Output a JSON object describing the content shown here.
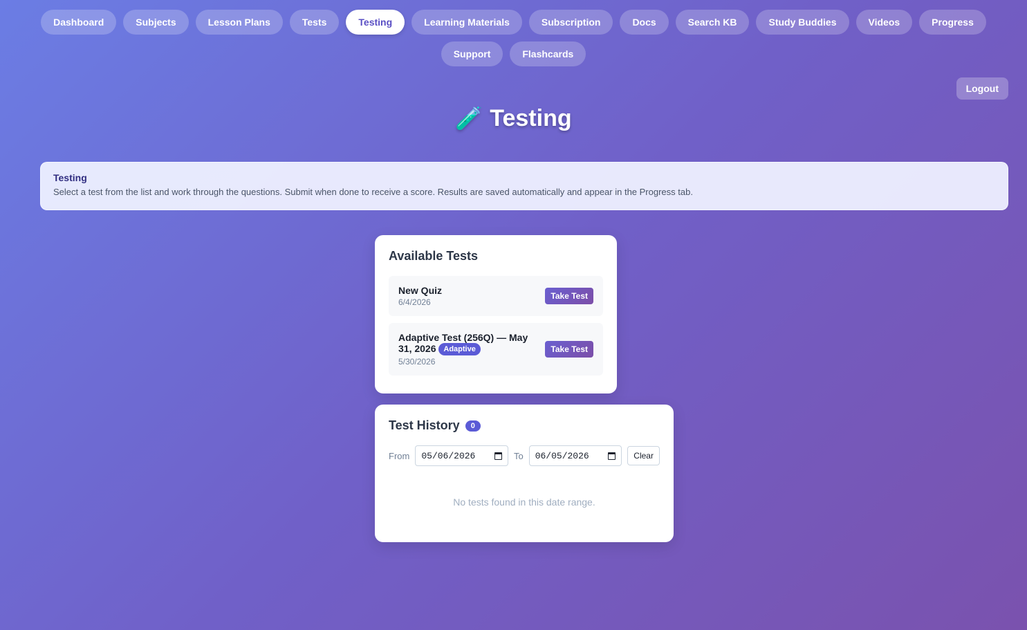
{
  "nav": {
    "items": [
      "Dashboard",
      "Subjects",
      "Lesson Plans",
      "Tests",
      "Testing",
      "Learning Materials",
      "Subscription",
      "Docs",
      "Search KB",
      "Study Buddies",
      "Videos",
      "Progress",
      "Support",
      "Flashcards"
    ],
    "active": "Testing"
  },
  "logout_label": "Logout",
  "page": {
    "icon": "🧪",
    "title": "Testing"
  },
  "info": {
    "title": "Testing",
    "text": "Select a test from the list and work through the questions. Submit when done to receive a score. Results are saved automatically and appear in the Progress tab."
  },
  "available": {
    "title": "Available Tests",
    "tests": [
      {
        "name": "New Quiz",
        "date": "6/4/2026",
        "badge": "",
        "button": "Take Test"
      },
      {
        "name": "Adaptive Test (256Q) — May 31, 2026",
        "date": "5/30/2026",
        "badge": "Adaptive",
        "button": "Take Test"
      }
    ]
  },
  "history": {
    "title": "Test History",
    "count": "0",
    "from_label": "From",
    "from_value": "05/06/2026",
    "to_label": "To",
    "to_value": "06/05/2026",
    "clear_label": "Clear",
    "empty_text": "No tests found in this date range."
  }
}
